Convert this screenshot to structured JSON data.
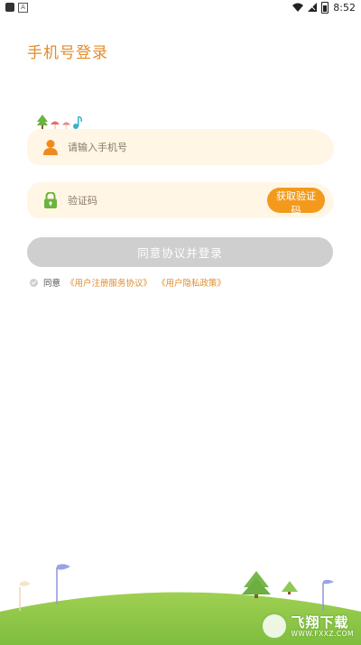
{
  "status_bar": {
    "time": "8:52",
    "app_icon_letter": "A"
  },
  "page": {
    "title": "手机号登录"
  },
  "phone": {
    "placeholder": "请输入手机号",
    "icon": "user-icon"
  },
  "code": {
    "placeholder": "验证码",
    "icon": "lock-icon",
    "get_code_label": "获取验证码"
  },
  "login_button": {
    "label": "同意协议并登录"
  },
  "agreement": {
    "prefix": "同意",
    "user_agreement": "《用户注册服务协议》",
    "privacy_policy": "《用户隐私政策》"
  },
  "watermark": {
    "title": "飞翔下载",
    "sub": "WWW.FXXZ.COM"
  },
  "colors": {
    "accent": "#e08c2e",
    "button_orange": "#f39a1c",
    "input_bg": "#fff6e6",
    "disabled_button": "#cfcfcf",
    "grass": "#8cc34a"
  }
}
